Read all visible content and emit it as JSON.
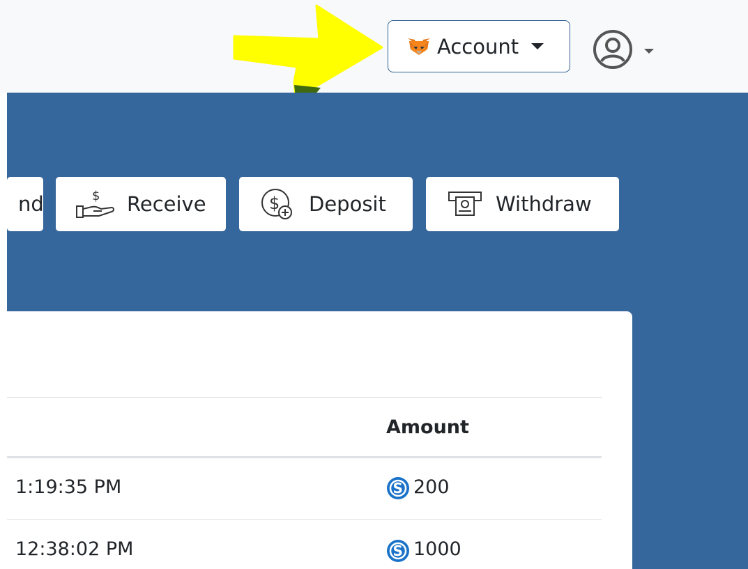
{
  "topbar": {
    "account_label": "Account",
    "account_icon": "metamask-fox-icon",
    "user_icon": "user-circle-icon"
  },
  "actions": [
    {
      "label": "nd",
      "icon": "send-icon"
    },
    {
      "label": "Receive",
      "icon": "hand-dollar-icon"
    },
    {
      "label": "Deposit",
      "icon": "dollar-plus-icon"
    },
    {
      "label": "Withdraw",
      "icon": "atm-cash-icon"
    }
  ],
  "table": {
    "amount_header": "Amount",
    "rows": [
      {
        "time": "1:19:35 PM",
        "amount": "200"
      },
      {
        "time": "12:38:02 PM",
        "amount": "1000"
      }
    ]
  },
  "colors": {
    "hero_bg": "#36679c",
    "account_border": "#2f5f94",
    "annotation_arrow": "#ffff00",
    "coin": "#1a73c8"
  }
}
